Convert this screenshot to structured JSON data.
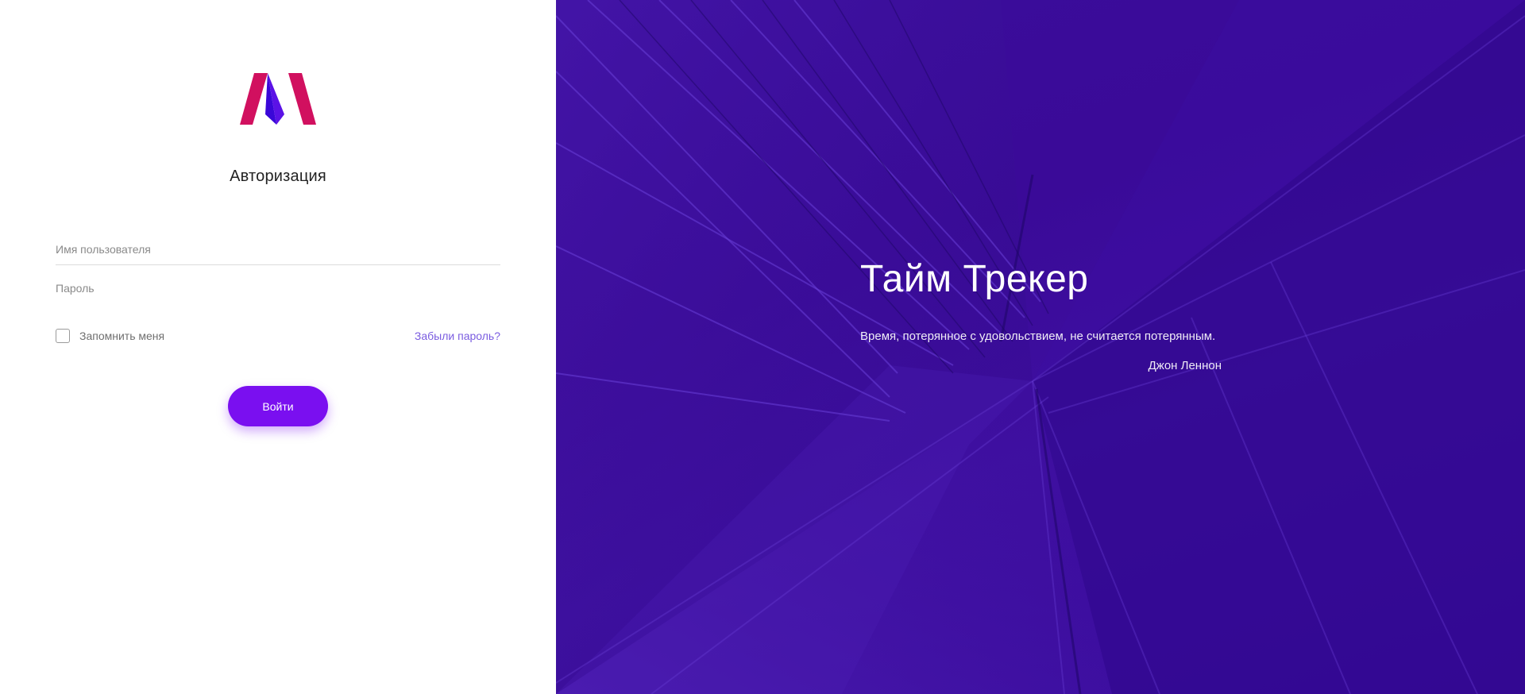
{
  "login": {
    "title": "Авторизация",
    "username_placeholder": "Имя пользователя",
    "password_placeholder": "Пароль",
    "remember_label": "Запомнить меня",
    "remember_checked": false,
    "forgot_label": "Забыли пароль?",
    "submit_label": "Войти"
  },
  "hero": {
    "title": "Тайм Трекер",
    "quote": "Время, потерянное с удовольствием, не считается потерянным.",
    "author": "Джон Леннон"
  },
  "icons": {
    "logo": "brand-logo-icon",
    "checkbox": "checkbox-icon"
  },
  "colors": {
    "accent": "#7a0ff0",
    "link": "#7a5ce0",
    "logo_magenta": "#d1105f",
    "logo_violet": "#5b12e6",
    "hero_background": "#3a0d9b"
  }
}
